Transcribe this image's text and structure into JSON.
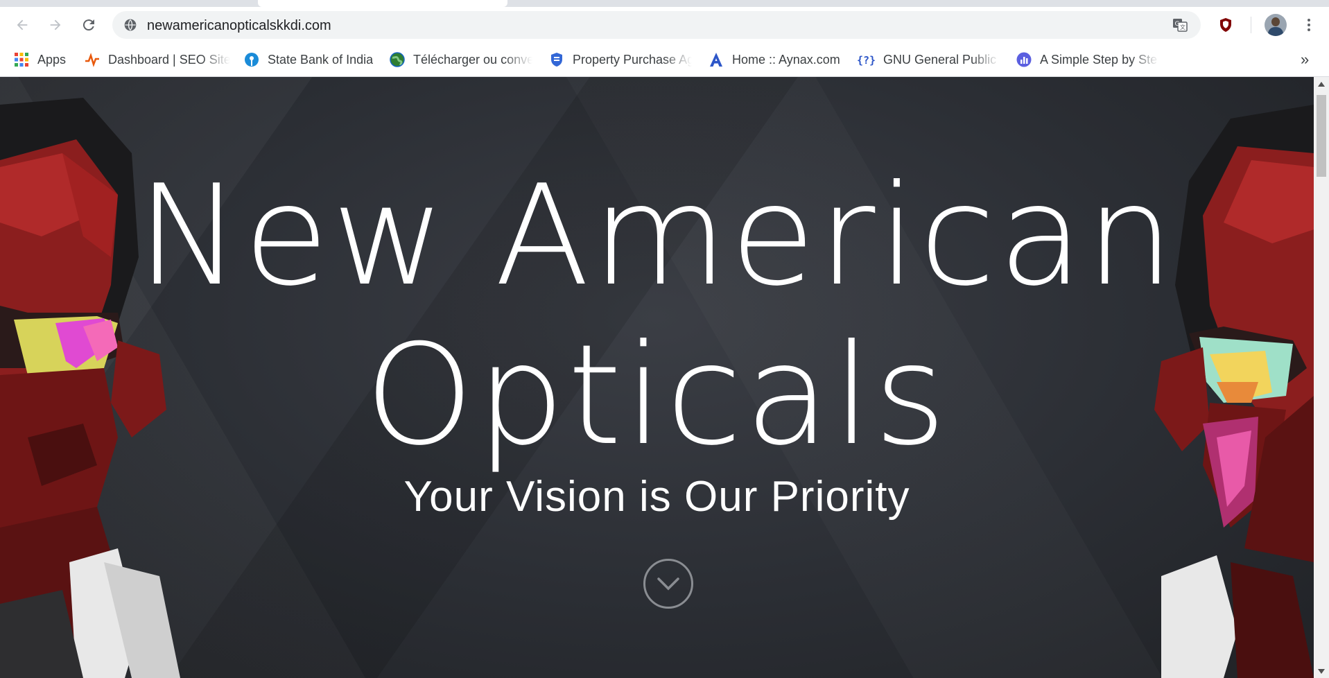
{
  "browser": {
    "address_url": "newamericanopticalskkdi.com",
    "bookmarks": [
      {
        "label": "Apps",
        "icon": "apps-grid-icon"
      },
      {
        "label": "Dashboard | SEO Site",
        "icon": "seo-pulse-icon"
      },
      {
        "label": "State Bank of India",
        "icon": "sbi-icon"
      },
      {
        "label": "Télécharger ou conve",
        "icon": "globe-icon"
      },
      {
        "label": "Property Purchase Ag",
        "icon": "shield-doc-icon"
      },
      {
        "label": "Home :: Aynax.com",
        "icon": "aynax-a-icon"
      },
      {
        "label": "GNU General Public L",
        "icon": "brackets-question-icon"
      },
      {
        "label": "A Simple Step by Ste",
        "icon": "chart-bars-icon"
      }
    ],
    "overflow_label": "»"
  },
  "hero": {
    "title_line1": "New American",
    "title_line2": "Opticals",
    "tagline": "Your Vision is Our Priority",
    "scroll_icon": "chevron-down-circle-icon"
  },
  "colors": {
    "page_bg": "#2b2e34",
    "text": "#ffffff",
    "accent_red": "#8b1a1a"
  }
}
